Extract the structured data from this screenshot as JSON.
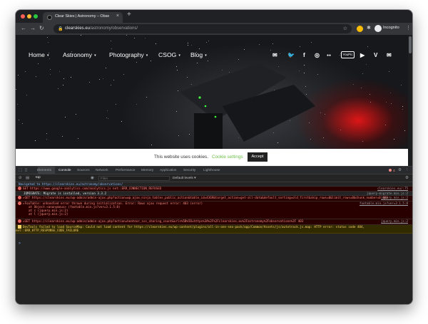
{
  "browser": {
    "tab_title": "Clear Skies | Astronomy – Obse",
    "tab_close": "×",
    "new_tab": "+",
    "url_host": "clearskies.eu",
    "url_path": "/astronomy/observations/",
    "profile": "Incognito",
    "icons": {
      "back": "←",
      "forward": "→",
      "reload": "↻",
      "lock": "🔒",
      "star": "☆",
      "extensions": "✱",
      "menu": "⋮"
    }
  },
  "site": {
    "nav": [
      {
        "label": "Home"
      },
      {
        "label": "Astronomy"
      },
      {
        "label": "Photography"
      },
      {
        "label": "CSOG"
      },
      {
        "label": "Blog"
      }
    ],
    "caret": "▾",
    "social": [
      "✉",
      "🐦",
      "f",
      "◎",
      "●●",
      "YouPic",
      "▶",
      "V",
      "✉"
    ],
    "cookie": {
      "text": "This website uses cookies.",
      "settings": "Cookie settings",
      "accept": "Accept"
    }
  },
  "devtools": {
    "tabs": [
      "Elements",
      "Console",
      "Sources",
      "Network",
      "Performance",
      "Memory",
      "Application",
      "Security",
      "Lighthouse"
    ],
    "active_tab": "Console",
    "error_count": "4",
    "context": "top",
    "filter_placeholder": "Filter",
    "levels": "Default levels ▾",
    "messages": [
      {
        "type": "info",
        "text": "Navigated to https://clearskies.eu/astronomy/observations/",
        "src": ""
      },
      {
        "type": "error",
        "text": "GET https://www.google-analytics.com/analytics.js net::ERR_CONNECTION_REFUSED",
        "src": "clearskies.eu/:75"
      },
      {
        "type": "plain",
        "text": "JQMIGRATE: Migrate is installed, version 3.3.2",
        "src": "jquery-migrate.min.js:2"
      },
      {
        "type": "error",
        "text": "▸GET https://clearskies.eu/wp-admin/admin-ajax.php?action=wp_ajax_ninja_tables_public_action&table_id=4369&target_action=get-all-data&default_sorting=old_first&skip_rows=0&limit_rows=0&chunk_number=0 403",
        "src": "jquery.min.js:2"
      },
      {
        "type": "error",
        "text": "▸FooTable: unhandled error thrown during initialization. Error: Rows ajax request error: 403 (error)",
        "src": "footable.min.js?ver=3.1.5:8",
        "sub": [
          "at Object.<anonymous> (footable.min.js?ver=3.1.5:8)",
          "at c (jquery.min.js:2)",
          "at l (jquery.min.js:2)"
        ]
      },
      {
        "type": "error",
        "text": "▸GET https://clearskies.eu/wp-admin/admin-ajax.php?action=heateor_sss_sharing_count&urls%5B%5D=https%3A%2F%2Fclearskies.eu%2Fastronomy%2Fobservations%2F 403",
        "src": "jquery.min.js:2"
      },
      {
        "type": "warn",
        "text": "DevTools failed to load SourceMap: Could not load content for https://clearskies.eu/wp-content/plugins/all-in-one-seo-pack/app/Common/Assets/js/autotrack.js.map: HTTP error: status code 404, net::ERR_HTTP_RESPONSE_CODE_FAILURE",
        "src": ""
      }
    ],
    "prompt": ">"
  }
}
